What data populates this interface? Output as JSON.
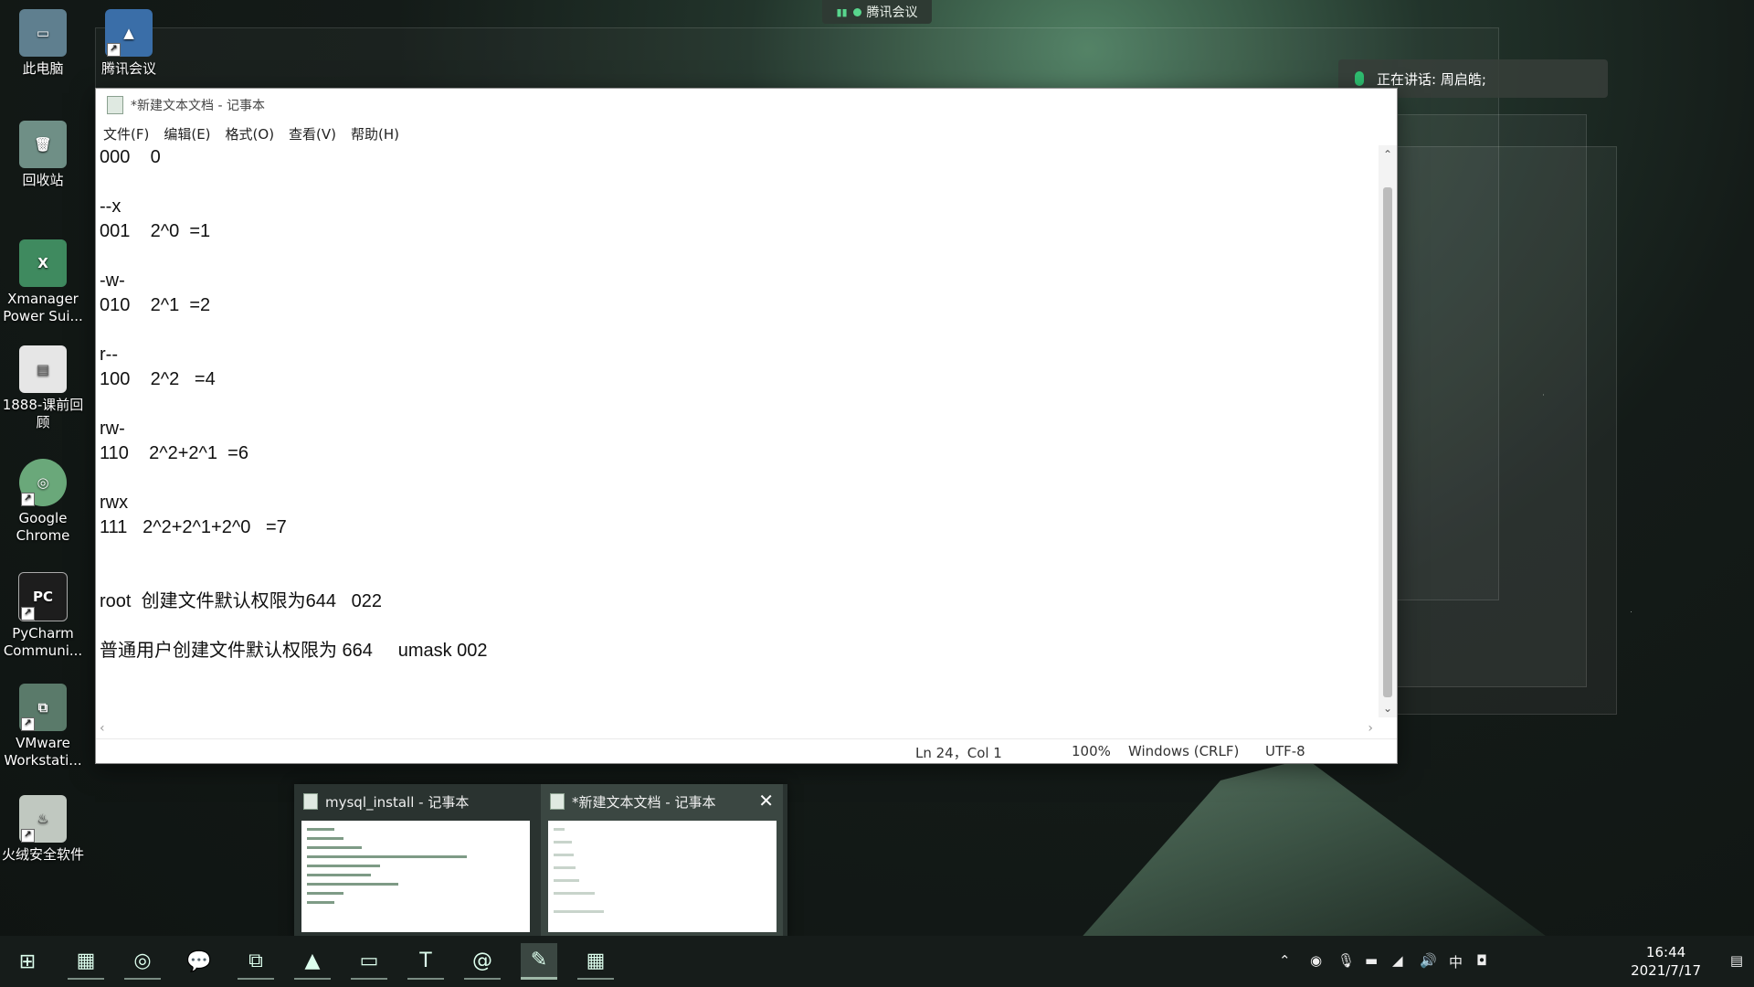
{
  "desktop": {
    "icons": [
      {
        "label": "此电脑",
        "icon": "computer-icon",
        "color": "#5f7f8f"
      },
      {
        "label": "腾讯会议",
        "icon": "tencent-meeting-icon",
        "color": "#3a6ea8"
      },
      {
        "label": "回收站",
        "icon": "recycle-bin-icon",
        "color": "#6f8f86"
      },
      {
        "label": "Xmanager Power Sui...",
        "icon": "xmanager-icon",
        "color": "#3f8a5f"
      },
      {
        "label": "1888-课前回顾",
        "icon": "document-icon",
        "color": "#e6e6e6"
      },
      {
        "label": "Google Chrome",
        "icon": "chrome-icon",
        "color": "#6aa87a"
      },
      {
        "label": "PyCharm Communi...",
        "icon": "pycharm-icon",
        "color": "#1d1d1d"
      },
      {
        "label": "VMware Workstati...",
        "icon": "vmware-icon",
        "color": "#5a7a6a"
      },
      {
        "label": "火绒安全软件",
        "icon": "huorong-icon",
        "color": "#c0c8c0"
      }
    ]
  },
  "meeting": {
    "top_label": "腾讯会议",
    "speaking_label": "正在讲话: 周启皓;"
  },
  "notepad": {
    "title": "*新建文本文档 - 记事本",
    "menu": [
      "文件(F)",
      "编辑(E)",
      "格式(O)",
      "查看(V)",
      "帮助(H)"
    ],
    "content": "000    0\n\n--x\n001    2^0  =1\n\n-w-\n010    2^1  =2\n\nr--\n100    2^2   =4\n\nrw-\n110    2^2+2^1  =6\n\nrwx\n111   2^2+2^1+2^0   =7\n\n\nroot  创建文件默认权限为644   022\n\n普通用户创建文件默认权限为 664     umask 002",
    "status": {
      "position": "Ln 24，Col 1",
      "zoom": "100%",
      "line_ending": "Windows (CRLF)",
      "encoding": "UTF-8"
    }
  },
  "thumbnails": [
    {
      "title": "mysql_install - 记事本"
    },
    {
      "title": "*新建文本文档 - 记事本"
    }
  ],
  "taskbar": {
    "apps": [
      {
        "name": "start-icon",
        "glyph": "⊞"
      },
      {
        "name": "app1-icon",
        "glyph": "▦"
      },
      {
        "name": "chrome-icon",
        "glyph": "◎"
      },
      {
        "name": "wechat-icon",
        "glyph": "💬"
      },
      {
        "name": "vmware-icon",
        "glyph": "⧉"
      },
      {
        "name": "tencent-meeting-icon",
        "glyph": "▲"
      },
      {
        "name": "file-explorer-icon",
        "glyph": "▭"
      },
      {
        "name": "typora-icon",
        "glyph": "T"
      },
      {
        "name": "snail-icon",
        "glyph": "@"
      },
      {
        "name": "notepad-icon",
        "glyph": "✎"
      },
      {
        "name": "app2-icon",
        "glyph": "▦"
      }
    ],
    "tray": {
      "ime": "中",
      "time": "16:44",
      "date": "2021/7/17"
    }
  }
}
